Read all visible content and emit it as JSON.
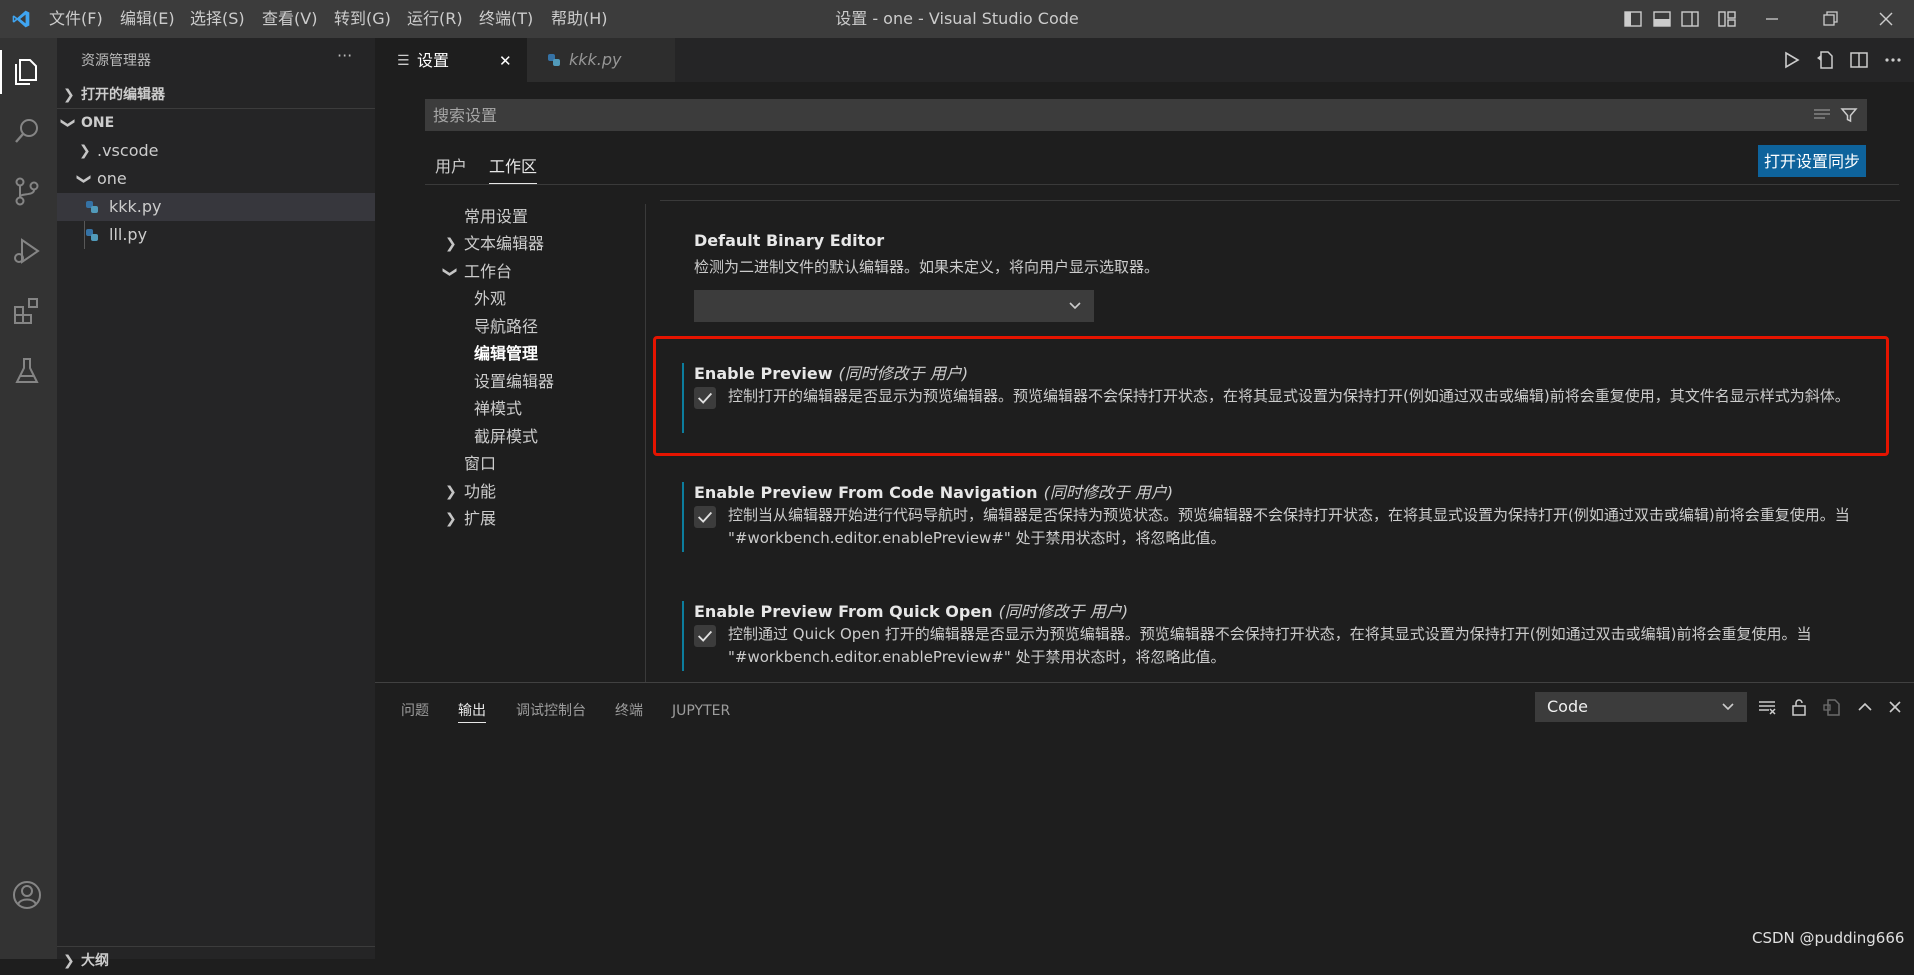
{
  "menu": [
    "文件(F)",
    "编辑(E)",
    "选择(S)",
    "查看(V)",
    "转到(G)",
    "运行(R)",
    "终端(T)",
    "帮助(H)"
  ],
  "window_title": "设置 - one - Visual Studio Code",
  "sidebar": {
    "title": "资源管理器",
    "more": "···",
    "open_editors": "打开的编辑器",
    "folder": "ONE",
    "tree": [
      ".vscode",
      "one",
      "kkk.py",
      "lll.py"
    ],
    "outline": "大纲"
  },
  "tabs": {
    "settings": "设置",
    "kkk": "kkk.py",
    "close": "✕"
  },
  "settings": {
    "search_placeholder": "搜索设置",
    "scope_user": "用户",
    "scope_workspace": "工作区",
    "sync_button": "打开设置同步",
    "toc": [
      "常用设置",
      "文本编辑器",
      "工作台",
      "外观",
      "导航路径",
      "编辑管理",
      "设置编辑器",
      "禅模式",
      "截屏模式",
      "窗口",
      "功能",
      "扩展"
    ],
    "items": [
      {
        "title": "Default Binary Editor",
        "modified": "",
        "desc": "检测为二进制文件的默认编辑器。如果未定义，将向用户显示选取器。"
      },
      {
        "title": "Enable Preview",
        "modified": "(同时修改于 用户)",
        "desc": "控制打开的编辑器是否显示为预览编辑器。预览编辑器不会保持打开状态，在将其显式设置为保持打开(例如通过双击或编辑)前将会重复使用，其文件名显示样式为斜体。"
      },
      {
        "title": "Enable Preview From Code Navigation",
        "modified": "(同时修改于 用户)",
        "desc": "控制当从编辑器开始进行代码导航时，编辑器是否保持为预览状态。预览编辑器不会保持打开状态，在将其显式设置为保持打开(例如通过双击或编辑)前将会重复使用。当 \"#workbench.editor.enablePreview#\" 处于禁用状态时，将忽略此值。"
      },
      {
        "title": "Enable Preview From Quick Open",
        "modified": "(同时修改于 用户)",
        "desc": "控制通过 Quick Open 打开的编辑器是否显示为预览编辑器。预览编辑器不会保持打开状态，在将其显式设置为保持打开(例如通过双击或编辑)前将会重复使用。当 \"#workbench.editor.enablePreview#\" 处于禁用状态时，将忽略此值。"
      }
    ]
  },
  "panel": {
    "tabs": [
      "问题",
      "输出",
      "调试控制台",
      "终端",
      "JUPYTER"
    ],
    "output_channel": "Code"
  },
  "watermark": "CSDN @pudding666",
  "colors": {
    "accent": "#007acc",
    "highlight_box": "#e51400",
    "sync_button": "#0e639c"
  }
}
